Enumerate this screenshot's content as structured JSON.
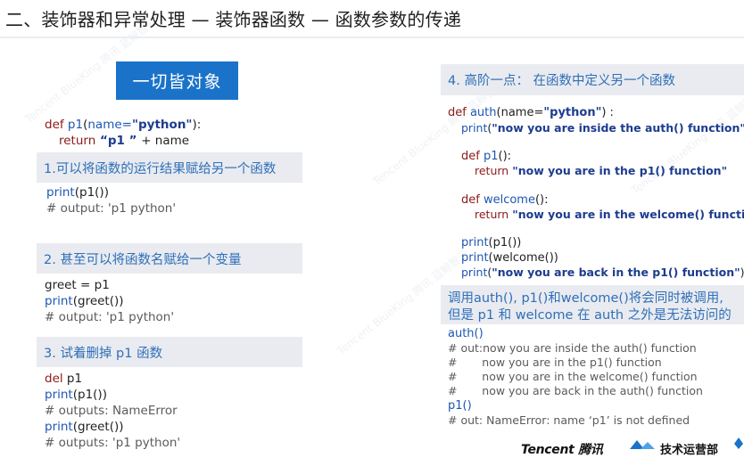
{
  "title": "二、装饰器和异常处理 — 装饰器函数 — 函数参数的传递",
  "cta": "一切皆对象",
  "left": {
    "intro": {
      "line1": {
        "kw": "def ",
        "fn": "p1",
        "a": "(",
        "b": "name=",
        "str": "\"python\"",
        "c": "):"
      },
      "line2": {
        "kw": "return",
        "s": " “p1 ” ",
        "rest": "+ name"
      }
    },
    "s1": {
      "heading": "1.可以将函数的运行结果赋给另一个函数",
      "code1_fn": "print",
      "code1_rest": "(p1())",
      "code2": "# output: 'p1 python'"
    },
    "s2": {
      "heading": "2. 甚至可以将函数名赋给一个变量",
      "l1_a": "greet",
      "l1_b": " = p1",
      "l2_fn": "print",
      "l2_rest": "(greet())",
      "l3": "# output: 'p1 python'"
    },
    "s3": {
      "heading": "3. 试着删掉 p1 函数",
      "l1_kw": "del",
      "l1_rest": " p1",
      "l2_fn": "print",
      "l2_rest": "(p1())",
      "l3": "# outputs: NameError",
      "l4_fn": "print",
      "l4_rest": "(greet())",
      "l5": "# outputs: 'p1 python'"
    }
  },
  "right": {
    "heading": "4. 高阶一点： 在函数中定义另一个函数",
    "code": {
      "l1": {
        "kw": "def ",
        "fn": "auth",
        "a": "(name=",
        "str": "\"python\"",
        "b": ") :"
      },
      "l2": {
        "fn": "print",
        "a": "(",
        "str": "\"now you are inside the auth() function\"",
        "b": ")"
      },
      "l3": {
        "kw": "def ",
        "fn": "p1",
        "a": "():"
      },
      "l4": {
        "kw": "return ",
        "str": "\"now you are in the p1() function\""
      },
      "l5": {
        "kw": "def ",
        "fn": "welcome",
        "a": "():"
      },
      "l6": {
        "kw": "return ",
        "str": "\"now you are in the welcome() function\""
      },
      "l7": {
        "fn": "print",
        "a": "(p1())"
      },
      "l8": {
        "fn": "print",
        "a": "(welcome())"
      },
      "l9": {
        "fn": "print",
        "a": "(",
        "str": "\"now you are back in the p1() function\"",
        "b": ")"
      }
    },
    "note_line1": "调用auth(), p1()和welcome()将会同时被调用,",
    "note_line2": "但是 p1 和 welcome 在 auth 之外是无法访问的",
    "after": {
      "l1": "auth()",
      "l2": "# out:now you are inside the auth() function",
      "l3": "#       now you are in the p1() function",
      "l4": "#       now you are in the welcome() function",
      "l5": "#       now you are back in the auth() function",
      "l6": "p1()",
      "l7": "# out: NameError: name ‘p1’ is not defined"
    }
  },
  "footer": {
    "brand1": "Tencent 腾讯",
    "brand2": "技术运营部"
  },
  "watermark": "Tencent BlueKing 腾讯 蓝鲸智云"
}
